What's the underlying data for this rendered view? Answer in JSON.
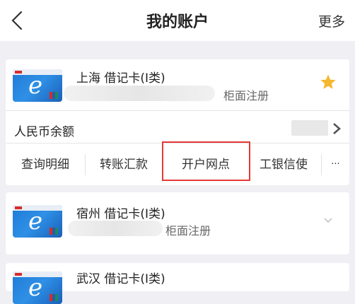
{
  "header": {
    "title": "我的账户",
    "more_label": "更多"
  },
  "accounts": [
    {
      "name": "上海 借记卡(Ⅰ类)",
      "reg_label": "柜面注册",
      "starred": true,
      "balance_label": "人民币余额",
      "actions": [
        {
          "label": "查询明细"
        },
        {
          "label": "转账汇款"
        },
        {
          "label": "开户网点"
        },
        {
          "label": "工银信使"
        },
        {
          "label": "···"
        }
      ]
    },
    {
      "name": "宿州 借记卡(Ⅰ类)",
      "reg_label": "柜面注册"
    },
    {
      "name": "武汉 借记卡(Ⅰ类)"
    }
  ],
  "colors": {
    "highlight": "#e53935",
    "star": "#f5b731",
    "card_blue": "#1f7ad6"
  }
}
